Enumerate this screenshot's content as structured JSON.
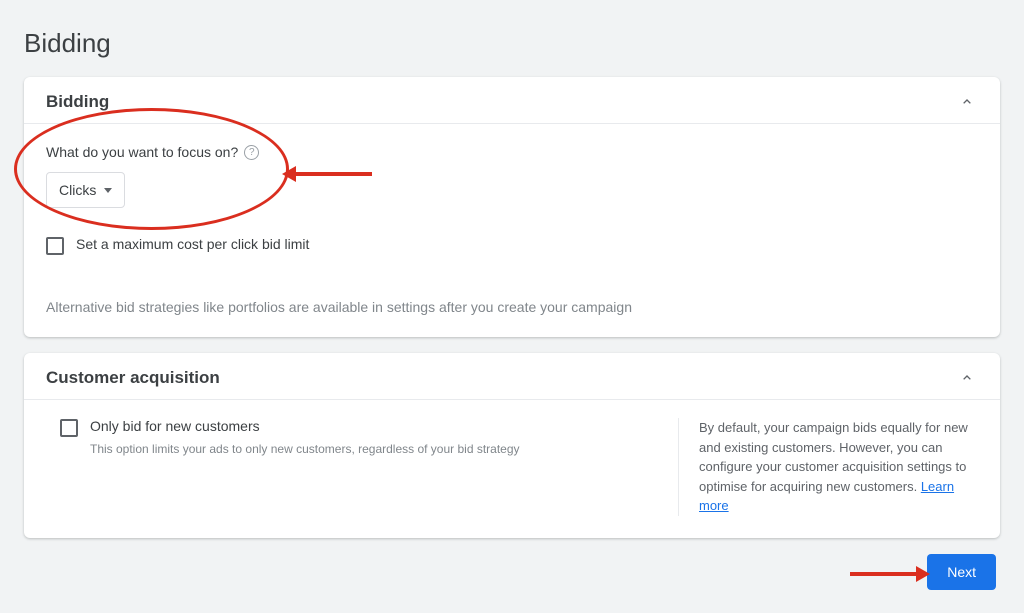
{
  "page": {
    "title": "Bidding"
  },
  "bidding_card": {
    "title": "Bidding",
    "focus_label": "What do you want to focus on?",
    "dropdown_value": "Clicks",
    "max_cpc_label": "Set a maximum cost per click bid limit",
    "alt_note": "Alternative bid strategies like portfolios are available in settings after you create your campaign"
  },
  "customer_card": {
    "title": "Customer acquisition",
    "only_new_label": "Only bid for new customers",
    "only_new_desc": "This option limits your ads to only new customers, regardless of your bid strategy",
    "side_text": "By default, your campaign bids equally for new and existing customers. However, you can configure your customer acquisition settings to optimise for acquiring new customers. ",
    "learn_more": "Learn more"
  },
  "footer": {
    "next_label": "Next"
  }
}
